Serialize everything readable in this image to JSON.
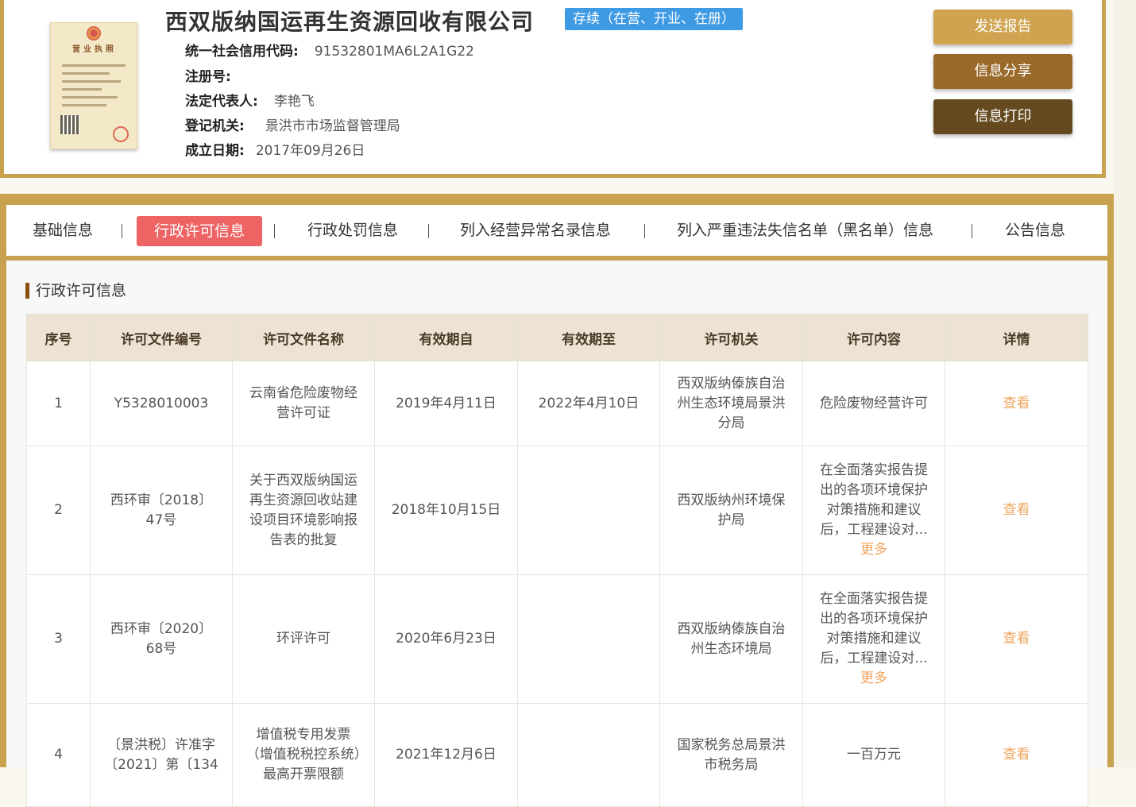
{
  "company": {
    "name": "西双版纳国运再生资源回收有限公司",
    "status": "存续（在营、开业、在册）",
    "fields": [
      {
        "label": "统一社会信用代码:",
        "value": "91532801MA6L2A1G22"
      },
      {
        "label": "注册号:",
        "value": ""
      },
      {
        "label": "法定代表人:",
        "value": "李艳飞"
      },
      {
        "label": "登记机关:",
        "value": "景洪市市场监督管理局"
      },
      {
        "label": "成立日期:",
        "value": "2017年09月26日"
      }
    ],
    "license_title": "营业执照"
  },
  "actions": {
    "send_report": "发送报告",
    "share": "信息分享",
    "print": "信息打印"
  },
  "tabs": [
    {
      "label": "基础信息"
    },
    {
      "label": "行政许可信息"
    },
    {
      "label": "行政处罚信息"
    },
    {
      "label": "列入经营异常名录信息"
    },
    {
      "label": "列入严重违法失信名单（黑名单）信息"
    },
    {
      "label": "公告信息"
    }
  ],
  "section_title": "行政许可信息",
  "table": {
    "headers": [
      "序号",
      "许可文件编号",
      "许可文件名称",
      "有效期自",
      "有效期至",
      "许可机关",
      "许可内容",
      "详情"
    ],
    "rows": [
      {
        "no": "1",
        "file_no": "Y5328010003",
        "file_name": "云南省危险废物经营许可证",
        "valid_from": "2019年4月11日",
        "valid_to": "2022年4月10日",
        "authority": "西双版纳傣族自治州生态环境局景洪分局",
        "content": "危险废物经营许可",
        "more": "",
        "detail": "查看"
      },
      {
        "no": "2",
        "file_no": "西环审〔2018〕47号",
        "file_name": "关于西双版纳国运再生资源回收站建设项目环境影响报告表的批复",
        "valid_from": "2018年10月15日",
        "valid_to": "",
        "authority": "西双版纳州环境保护局",
        "content": "在全面落实报告提出的各项环境保护对策措施和建议后，工程建设对...",
        "more": "更多",
        "detail": "查看"
      },
      {
        "no": "3",
        "file_no": "西环审〔2020〕68号",
        "file_name": "环评许可",
        "valid_from": "2020年6月23日",
        "valid_to": "",
        "authority": "西双版纳傣族自治州生态环境局",
        "content": "在全面落实报告提出的各项环境保护对策措施和建议后，工程建设对...",
        "more": "更多",
        "detail": "查看"
      },
      {
        "no": "4",
        "file_no": "〔景洪税〕许准字〔2021〕第〔134",
        "file_name": "增值税专用发票（增值税税控系统）最高开票限额",
        "valid_from": "2021年12月6日",
        "valid_to": "",
        "authority": "国家税务总局景洪市税务局",
        "content": "一百万元",
        "more": "",
        "detail": "查看"
      }
    ]
  },
  "colors": {
    "gold_border": "#c9a24f",
    "status_blue": "#3f9ae4",
    "active_tab": "#ee6363",
    "link_orange": "#efa45e",
    "btn_send": "#cfa34f",
    "btn_share": "#9a6a2a",
    "btn_print": "#654a20"
  }
}
